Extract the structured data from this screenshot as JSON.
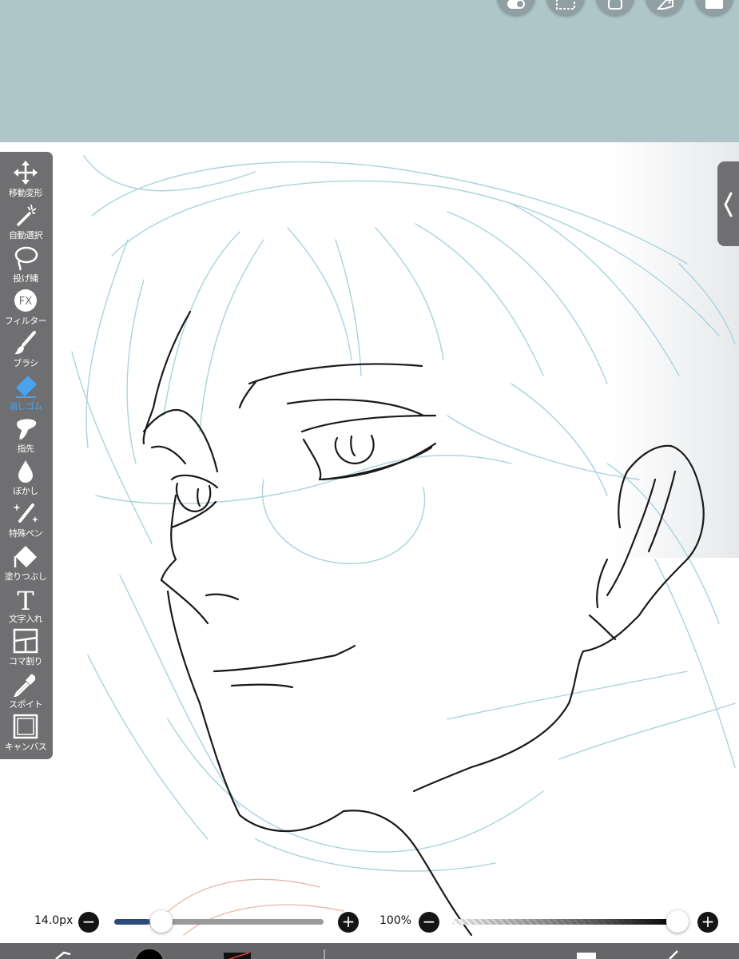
{
  "toolbar": {
    "tools": [
      {
        "label": "移動変形",
        "icon": "move-icon"
      },
      {
        "label": "自動選択",
        "icon": "magic-wand-icon"
      },
      {
        "label": "投げ縄",
        "icon": "lasso-icon"
      },
      {
        "label": "フィルター",
        "icon": "fx-icon",
        "icon_text": "FX"
      },
      {
        "label": "ブラシ",
        "icon": "brush-icon"
      },
      {
        "label": "消しゴム",
        "icon": "eraser-icon",
        "active": true
      },
      {
        "label": "指先",
        "icon": "finger-icon"
      },
      {
        "label": "ぼかし",
        "icon": "blur-drop-icon"
      },
      {
        "label": "特殊ペン",
        "icon": "special-pen-icon"
      },
      {
        "label": "塗りつぶし",
        "icon": "fill-bucket-icon"
      },
      {
        "label": "文字入れ",
        "icon": "text-icon",
        "icon_text": "T"
      },
      {
        "label": "コマ割り",
        "icon": "panel-divide-icon"
      },
      {
        "label": "スポイト",
        "icon": "eyedropper-icon"
      },
      {
        "label": "キャンバス",
        "icon": "canvas-icon"
      }
    ],
    "active_color": "#4aa3ee",
    "background": "#6f6f71"
  },
  "top_buttons": [
    "toggle-icon",
    "selection-icon",
    "layer-icon",
    "material-icon",
    "menu-icon"
  ],
  "brush_size": {
    "label": "14.0px",
    "minus": "−",
    "plus": "+",
    "level": 0.13
  },
  "opacity": {
    "label": "100%",
    "minus": "−",
    "plus": "+",
    "level": 1.0
  },
  "colors": {
    "top_area": "#aec6c9",
    "canvas": "#ffffff",
    "ink": "#1a1a1a",
    "sketch": "#a9d3dc"
  }
}
